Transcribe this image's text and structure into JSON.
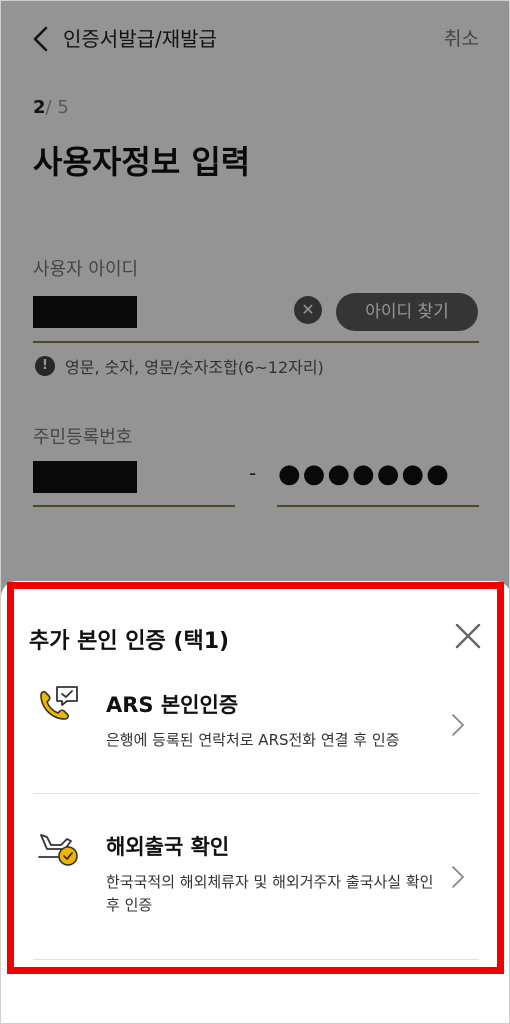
{
  "header": {
    "title": "인증서발급/재발급",
    "cancel_label": "취소"
  },
  "step": {
    "current": "2",
    "total": "/ 5"
  },
  "page_title": "사용자정보 입력",
  "user_id": {
    "label": "사용자 아이디",
    "find_button": "아이디 찾기",
    "hint": "영문, 숫자, 영문/숫자조합(6~12자리)"
  },
  "resident_number": {
    "label": "주민등록번호",
    "dash": "-",
    "masked_back": "●●●●●●●"
  },
  "sheet": {
    "title": "추가 본인 인증 (택1)",
    "options": [
      {
        "title": "ARS 본인인증",
        "description": "은행에 등록된 연락처로 ARS전화 연결 후 인증",
        "icon": "phone-chat-icon"
      },
      {
        "title": "해외출국 확인",
        "description": "한국국적의 해외체류자 및 해외거주자 출국사실 확인 후 인증",
        "icon": "airplane-check-icon"
      }
    ]
  },
  "colors": {
    "underline": "#8a7a3c",
    "highlight_box": "#f20000",
    "icon_accent": "#f2b600"
  }
}
